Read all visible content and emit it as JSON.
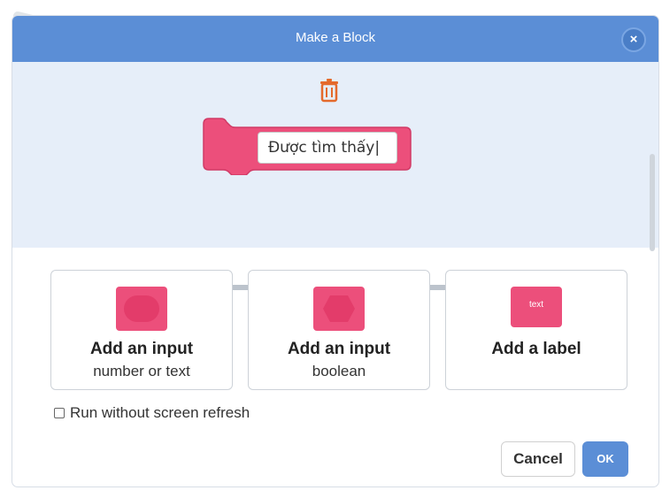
{
  "dialog": {
    "title": "Make a Block",
    "close_label": "×"
  },
  "block": {
    "input_value": "Được tìm thấy|"
  },
  "options": [
    {
      "title": "Add an input",
      "subtitle": "number or text",
      "icon": "number-input-icon"
    },
    {
      "title": "Add an input",
      "subtitle": "boolean",
      "icon": "boolean-input-icon"
    },
    {
      "title": "Add a label",
      "icon_text": "text",
      "icon": "label-icon"
    }
  ],
  "checkbox": {
    "label": "Run without screen refresh",
    "checked": false
  },
  "buttons": {
    "cancel": "Cancel",
    "ok": "OK"
  },
  "colors": {
    "titlebar": "#5b8ed6",
    "workspace": "#e6eef9",
    "block": "#ec4f7b",
    "trash": "#e46a2c"
  }
}
